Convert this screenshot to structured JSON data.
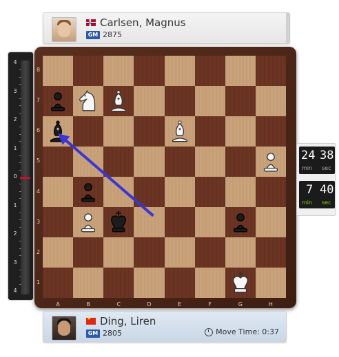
{
  "top_player": {
    "name": "Carlsen, Magnus",
    "title": "GM",
    "rating": "2875",
    "flag": "norway-flag"
  },
  "bottom_player": {
    "name": "Ding, Liren",
    "title": "GM",
    "rating": "2805",
    "flag": "china-flag",
    "move_time": "Move Time: 0:37"
  },
  "eval_bar": {
    "labels": [
      "4",
      "3",
      "2",
      "1",
      "0",
      "1",
      "2",
      "3",
      "4"
    ],
    "marker_color": "#c8102e"
  },
  "board": {
    "files": [
      "A",
      "B",
      "C",
      "D",
      "E",
      "F",
      "G",
      "H"
    ],
    "ranks": [
      "8",
      "7",
      "6",
      "5",
      "4",
      "3",
      "2",
      "1"
    ],
    "pieces": [
      {
        "square": "a7",
        "piece": "pawn",
        "color": "black"
      },
      {
        "square": "b7",
        "piece": "knight",
        "color": "white"
      },
      {
        "square": "c7",
        "piece": "bishop",
        "color": "white"
      },
      {
        "square": "a6",
        "piece": "bishop",
        "color": "black"
      },
      {
        "square": "e6",
        "piece": "bishop",
        "color": "white"
      },
      {
        "square": "h5",
        "piece": "pawn",
        "color": "white"
      },
      {
        "square": "b4",
        "piece": "pawn",
        "color": "black"
      },
      {
        "square": "b3",
        "piece": "pawn",
        "color": "white"
      },
      {
        "square": "c3",
        "piece": "king",
        "color": "black"
      },
      {
        "square": "g3",
        "piece": "pawn",
        "color": "black"
      },
      {
        "square": "g1",
        "piece": "king",
        "color": "white"
      }
    ],
    "arrow": {
      "from": "d3",
      "to": "a6",
      "color": "#3a35d8"
    },
    "light_square_color": "#c9a27a",
    "dark_square_color": "#6b3423"
  },
  "clocks": {
    "top": {
      "min": "24",
      "sec": "38",
      "min_label": "min",
      "sec_label": "sec"
    },
    "bottom": {
      "min": "7",
      "sec": "40",
      "min_label": "min",
      "sec_label": "sec"
    }
  }
}
